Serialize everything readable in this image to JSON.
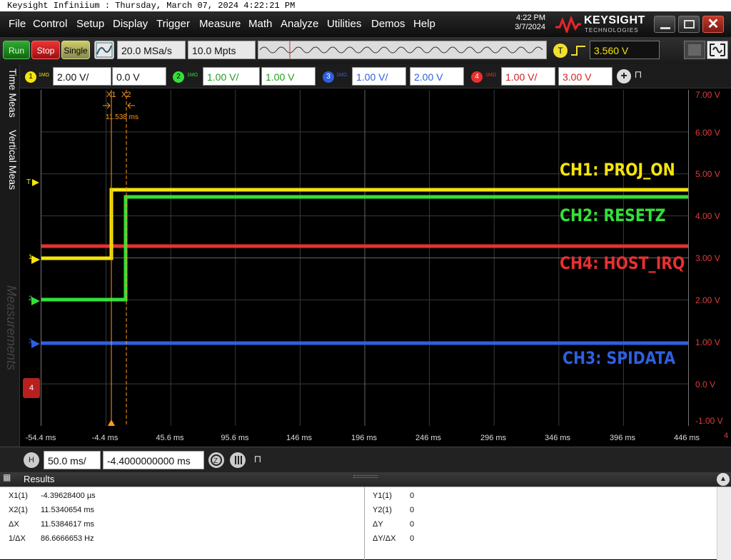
{
  "window": {
    "title": "Keysight Infiniium : Thursday, March 07, 2024 4:22:21 PM"
  },
  "menu": [
    "File",
    "Control",
    "Setup",
    "Display",
    "Trigger",
    "Measure",
    "Math",
    "Analyze",
    "Utilities",
    "Demos",
    "Help"
  ],
  "clock": {
    "time": "4:22 PM",
    "date": "3/7/2024"
  },
  "brand": {
    "name": "KEYSIGHT",
    "sub": "TECHNOLOGIES"
  },
  "toolbar": {
    "run": "Run",
    "stop": "Stop",
    "single": "Single",
    "sample_rate": "20.0 MSa/s",
    "memory_depth": "10.0 Mpts",
    "trigger_badge": "T",
    "trigger_level": "3.560 V"
  },
  "channels": [
    {
      "num": "1",
      "imp": "1MΩ",
      "scale": "2.00 V/",
      "offset": "0.0 V",
      "color": "#f5e50a"
    },
    {
      "num": "2",
      "imp": "1MΩ",
      "scale": "1.00 V/",
      "offset": "1.00 V",
      "color": "#33e03a"
    },
    {
      "num": "3",
      "imp": "1MΩ",
      "scale": "1.00 V/",
      "offset": "2.00 V",
      "color": "#2f5fe0"
    },
    {
      "num": "4",
      "imp": "1MΩ",
      "scale": "1.00 V/",
      "offset": "3.00 V",
      "color": "#e83030"
    }
  ],
  "sidetabs": {
    "time_meas": "Time Meas",
    "vertical_meas": "Vertical Meas",
    "measurements": "Measurements"
  },
  "cursors": {
    "x1": "X1",
    "x2": "X2",
    "delta": "11.538 ms"
  },
  "waveform_labels": {
    "ch1": "CH1: PROJ_ON",
    "ch2": "CH2: RESETZ",
    "ch3": "CH3: SPIDATA",
    "ch4": "CH4: HOST_IRQ"
  },
  "markers": {
    "trigger": "T",
    "ch1": "1",
    "ch2": "2",
    "ch3": "3",
    "ch4": "4"
  },
  "y_axis": [
    "7.00 V",
    "6.00 V",
    "5.00 V",
    "4.00 V",
    "3.00 V",
    "2.00 V",
    "1.00 V",
    "0.0 V",
    "-1.00 V"
  ],
  "x_axis": [
    "-54.4 ms",
    "-4.4 ms",
    "45.6 ms",
    "95.6 ms",
    "146 ms",
    "196 ms",
    "246 ms",
    "296 ms",
    "346 ms",
    "396 ms",
    "446 ms"
  ],
  "x_axis_extra": "4",
  "horizontal": {
    "badge": "H",
    "scale": "50.0 ms/",
    "position": "-4.4000000000 ms"
  },
  "results": {
    "title": "Results",
    "left": [
      {
        "label": "X1(1)",
        "value": "-4.39628400 µs"
      },
      {
        "label": "X2(1)",
        "value": "11.5340654 ms"
      },
      {
        "label": "ΔX",
        "value": "11.5384617 ms"
      },
      {
        "label": "1/ΔX",
        "value": "86.6666653 Hz"
      }
    ],
    "right": [
      {
        "label": "Y1(1)",
        "value": "0"
      },
      {
        "label": "Y2(1)",
        "value": "0"
      },
      {
        "label": "ΔY",
        "value": "0"
      },
      {
        "label": "ΔY/ΔX",
        "value": "0"
      }
    ]
  },
  "colors": {
    "ch1": "#f5e50a",
    "ch2": "#33e03a",
    "ch3": "#2f5fe0",
    "ch4": "#e83030",
    "cursor": "#ff9a1a",
    "axis_labels": "#e23b3b"
  }
}
